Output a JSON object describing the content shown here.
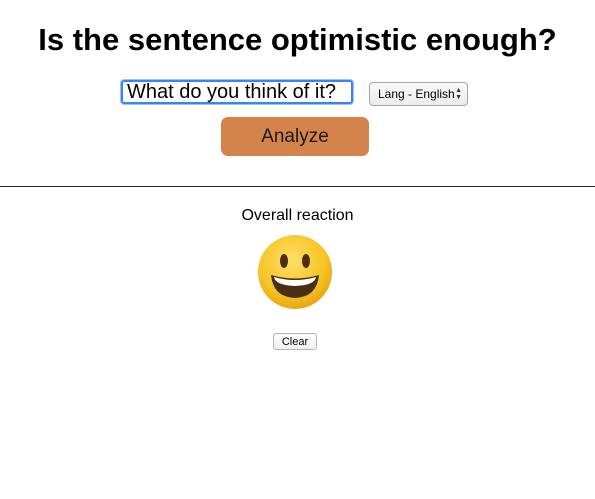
{
  "header": {
    "title": "Is the sentence optimistic enough?"
  },
  "form": {
    "sentence_value": "What do you think of it?",
    "language_selected": "Lang - English",
    "analyze_label": "Analyze"
  },
  "result": {
    "label": "Overall reaction",
    "emoji_icon": "grinning-face-icon",
    "clear_label": "Clear"
  },
  "colors": {
    "analyze_button": "#d4844a",
    "input_focus": "#3b82f6",
    "emoji_face": "#f7c325"
  }
}
